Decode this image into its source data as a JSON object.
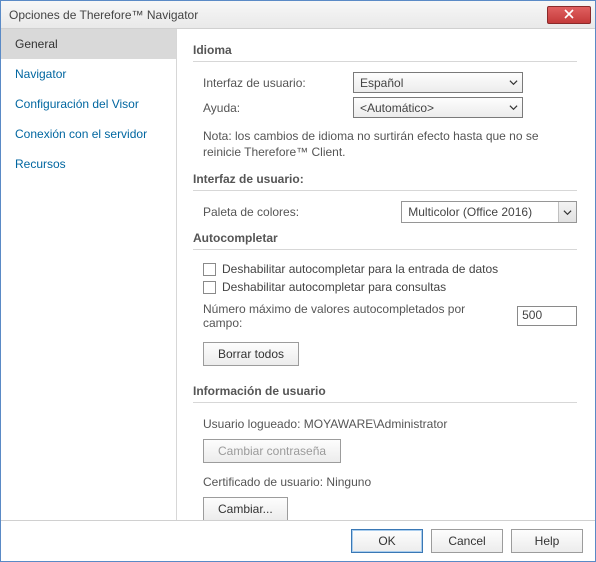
{
  "window": {
    "title": "Opciones de Therefore™ Navigator"
  },
  "sidebar": {
    "items": [
      {
        "label": "General",
        "selected": true
      },
      {
        "label": "Navigator",
        "selected": false
      },
      {
        "label": "Configuración del Visor",
        "selected": false
      },
      {
        "label": "Conexión con el servidor",
        "selected": false
      },
      {
        "label": "Recursos",
        "selected": false
      }
    ]
  },
  "sections": {
    "idioma": {
      "heading": "Idioma",
      "ui_label": "Interfaz de usuario:",
      "ui_value": "Español",
      "help_label": "Ayuda:",
      "help_value": "<Automático>",
      "note": "Nota: los cambios de idioma no surtirán efecto hasta que no se reinicie Therefore™ Client."
    },
    "ui": {
      "heading": "Interfaz de usuario:",
      "palette_label": "Paleta de colores:",
      "palette_value": "Multicolor (Office 2016)"
    },
    "autocomplete": {
      "heading": "Autocompletar",
      "disable_entry": "Deshabilitar autocompletar para la entrada de datos",
      "disable_query": "Deshabilitar autocompletar para consultas",
      "max_label": "Número máximo de valores autocompletados por campo:",
      "max_value": "500",
      "clear_all": "Borrar todos"
    },
    "userinfo": {
      "heading": "Información de usuario",
      "logged_user_label": "Usuario logueado:",
      "logged_user_value": "MOYAWARE\\Administrator",
      "change_password": "Cambiar contraseña",
      "cert_label": "Certificado de usuario:",
      "cert_value": "Ninguno",
      "change": "Cambiar..."
    }
  },
  "footer": {
    "ok": "OK",
    "cancel": "Cancel",
    "help": "Help"
  }
}
